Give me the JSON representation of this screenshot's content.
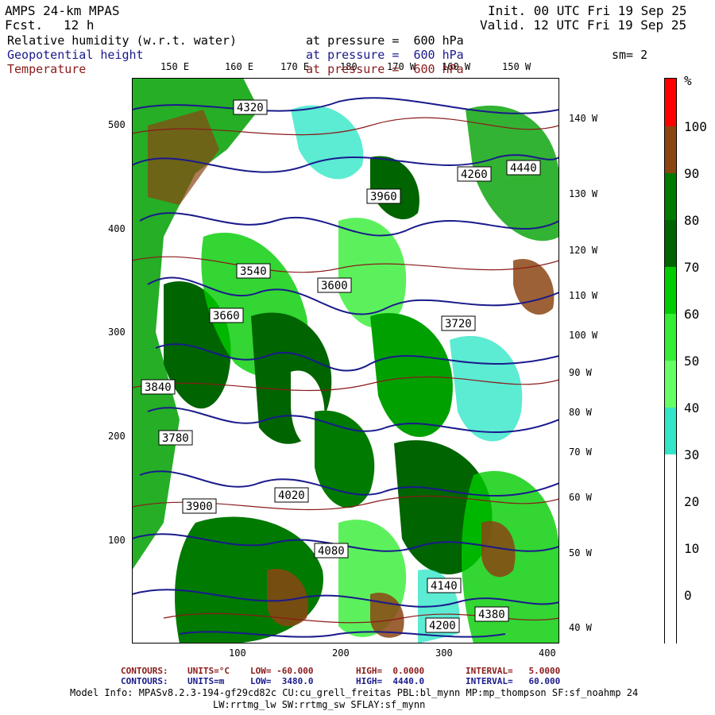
{
  "header": {
    "model": "AMPS 24-km MPAS",
    "forecast_label": "Fcst.",
    "forecast_hours": "12 h",
    "init": "Init. 00 UTC Fri 19 Sep 25",
    "valid": "Valid. 12 UTC Fri 19 Sep 25"
  },
  "fields": [
    {
      "name": "Relative humidity (w.r.t. water)",
      "level": "at pressure =  600 hPa",
      "color": "#000000"
    },
    {
      "name": "Geopotential height",
      "level": "at pressure =  600 hPa",
      "color": "#1a1a8c"
    },
    {
      "name": "Temperature",
      "level": "at pressure =  600 hPa",
      "color": "#8b1a1a"
    }
  ],
  "smoothing": "sm= 2",
  "top_lon_labels": [
    "150 E",
    "160 E",
    "170 E",
    "180",
    "170 W",
    "160 W",
    "150 W"
  ],
  "right_lon_labels": [
    "140 W",
    "130 W",
    "120 W",
    "110 W",
    "100 W",
    "90 W",
    "80 W",
    "70 W",
    "60 W",
    "50 W",
    "40 W"
  ],
  "y_axis_labels": [
    "500",
    "400",
    "300",
    "200",
    "100"
  ],
  "x_axis_labels": [
    "100",
    "200",
    "300",
    "400"
  ],
  "colorbar": {
    "unit": "%",
    "labels": [
      "100",
      "90",
      "80",
      "70",
      "60",
      "50",
      "40",
      "30",
      "20",
      "10",
      "0"
    ],
    "colors": [
      "#ff0000",
      "#8b4513",
      "#007a00",
      "#006400",
      "#00cc00",
      "#33ee33",
      "#66ff66",
      "#33e6c8",
      "#ffffff",
      "#ffffff",
      "#ffffff",
      "#ffffff"
    ]
  },
  "height_contour_labels": [
    "4320",
    "4260",
    "4200",
    "4140",
    "4080",
    "4020",
    "3960",
    "3900",
    "3840",
    "3780",
    "3720",
    "3660",
    "3600",
    "3540",
    "4380",
    "4440"
  ],
  "contour_info": [
    {
      "label": "CONTOURS:",
      "units": "UNITS=°C",
      "low": "LOW= -60.000",
      "high": "HIGH=  0.0000",
      "interval": "INTERVAL=   5.0000",
      "color": "#8b1a1a"
    },
    {
      "label": "CONTOURS:",
      "units": "UNITS=m",
      "low": "LOW=  3480.0",
      "high": "HIGH=  4440.0",
      "interval": "INTERVAL=   60.000",
      "color": "#1a1a8c"
    }
  ],
  "model_info_line1": "Model Info: MPASv8.2.3-194-gf29cd82c CU:cu_grell_freitas PBL:bl_mynn MP:mp_thompson SF:sf_noahmp 24",
  "model_info_line2": "LW:rrtmg_lw SW:rrtmg_sw SFLAY:sf_mynn"
}
